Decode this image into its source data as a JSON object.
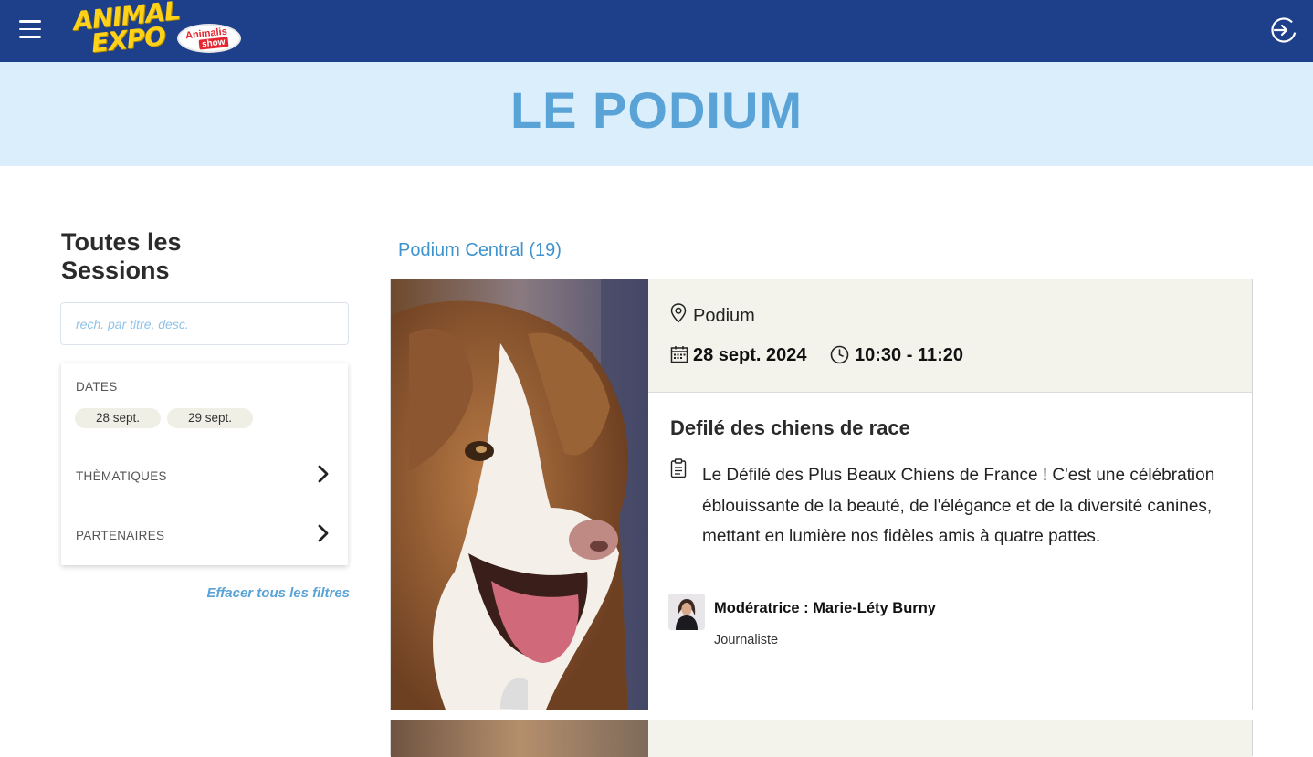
{
  "header": {
    "logo_line1": "ANIMAL",
    "logo_line2": "EXPO",
    "logo_badge_top": "Animalis",
    "logo_badge_bottom": "show",
    "menu_icon": "hamburger-menu-icon",
    "login_icon": "login-arrow-icon",
    "bg_color": "#1e3f8a"
  },
  "banner": {
    "title": "LE PODIUM",
    "bg_color": "#dbeefb",
    "title_color": "#5aa3d7"
  },
  "sidebar": {
    "title": "Toutes les Sessions",
    "search_placeholder": "rech. par titre, desc.",
    "dates_label": "DATES",
    "dates": [
      "28 sept.",
      "29 sept."
    ],
    "themes_label": "THÈMATIQUES",
    "partners_label": "PARTENAIRES",
    "clear_label": "Effacer tous les filtres"
  },
  "main": {
    "tab_label": "Podium Central (19)",
    "session": {
      "place": "Podium",
      "date": "28 sept. 2024",
      "time": "10:30 - 11:20",
      "title": "Defilé des chiens de race",
      "description": "Le Défilé des Plus Beaux Chiens de France ! C'est une célébration éblouissante de la beauté, de l'élégance et de la diversité canines, mettant en lumière nos fidèles amis à quatre pattes.",
      "moderator": "Modératrice : Marie-Léty Burny",
      "moderator_role": "Journaliste"
    }
  },
  "colors": {
    "accent": "#3f93cf",
    "card_header": "#f3f3ec",
    "chip": "#f0efe6"
  }
}
